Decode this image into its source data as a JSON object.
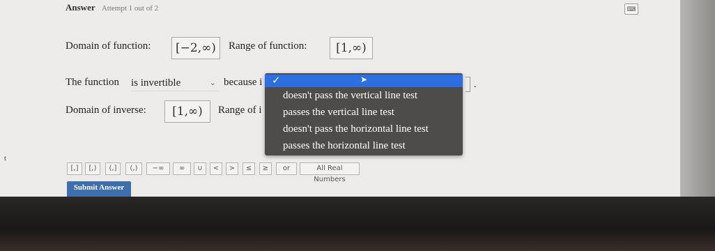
{
  "header": {
    "title": "Answer",
    "attempt": "Attempt 1 out of 2"
  },
  "corner_button": "⌨",
  "domain": {
    "label": "Domain of function:",
    "value": "[−2,∞)"
  },
  "range": {
    "label": "Range of function:",
    "value": "[1,∞)"
  },
  "invertible": {
    "prefix": "The function",
    "selected": "is invertible",
    "because": "because i"
  },
  "dropdown": {
    "check": "✓",
    "options": [
      "doesn't pass the vertical line test",
      "passes the vertical line test",
      "doesn't pass the horizontal line test",
      "passes the horizontal line test"
    ]
  },
  "inverse": {
    "domain_label": "Domain of inverse:",
    "domain_value": "[1,∞)",
    "range_label": "Range of i"
  },
  "toolbar": {
    "buttons": [
      "[,]",
      "[,)",
      "(,]",
      "(,)",
      "−∞",
      "∞",
      "∪",
      "<",
      ">",
      "≤",
      "≥",
      "or",
      "All Real Numbers"
    ]
  },
  "submit_label": "Submit Answer"
}
